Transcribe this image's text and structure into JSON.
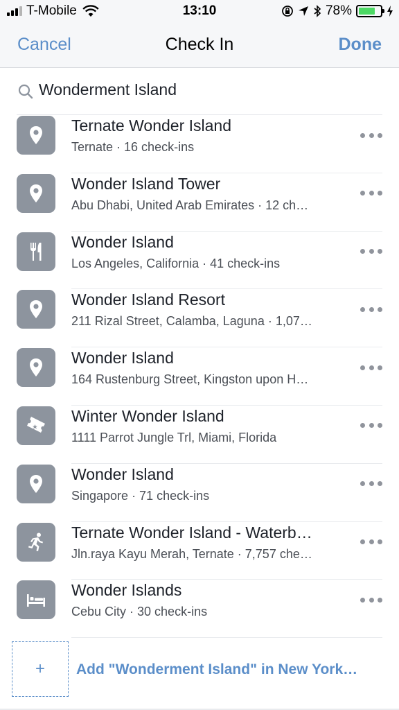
{
  "status_bar": {
    "carrier": "T-Mobile",
    "time": "13:10",
    "battery": "78%",
    "battery_level": 0.78,
    "icons": [
      "signal-icon",
      "wifi-icon",
      "orientation-lock-icon",
      "location-arrow-icon",
      "bluetooth-icon",
      "battery-icon",
      "charging-icon"
    ]
  },
  "nav": {
    "cancel_label": "Cancel",
    "title": "Check In",
    "done_label": "Done"
  },
  "search": {
    "value": "Wonderment Island",
    "icon": "search-icon"
  },
  "results": [
    {
      "name": "Ternate Wonder Island",
      "subtitle": "Ternate · 16 check-ins",
      "icon": "location-pin-icon"
    },
    {
      "name": "Wonder Island Tower",
      "subtitle": "Abu Dhabi, United Arab Emirates · 12 ch…",
      "icon": "location-pin-icon"
    },
    {
      "name": "Wonder Island",
      "subtitle": "Los Angeles, California · 41 check-ins",
      "icon": "restaurant-icon"
    },
    {
      "name": "Wonder Island Resort",
      "subtitle": "211 Rizal Street, Calamba, Laguna · 1,07…",
      "icon": "location-pin-icon"
    },
    {
      "name": "Wonder Island",
      "subtitle": "164 Rustenburg Street, Kingston upon H…",
      "icon": "location-pin-icon"
    },
    {
      "name": "Winter Wonder Island",
      "subtitle": "1111 Parrot Jungle Trl, Miami, Florida",
      "icon": "ticket-icon"
    },
    {
      "name": "Wonder Island",
      "subtitle": "Singapore · 71 check-ins",
      "icon": "location-pin-icon"
    },
    {
      "name": "Ternate Wonder Island - Waterb…",
      "subtitle": "Jln.raya Kayu Merah, Ternate · 7,757 che…",
      "icon": "running-person-icon"
    },
    {
      "name": "Wonder Islands",
      "subtitle": "Cebu City · 30 check-ins",
      "icon": "bed-icon"
    }
  ],
  "add_place": {
    "plus": "+",
    "label": "Add \"Wonderment Island\" in New York…"
  },
  "colors": {
    "accent": "#5b8ec9",
    "icon_bg": "#8d949e",
    "bar_bg": "#f6f7f9"
  }
}
